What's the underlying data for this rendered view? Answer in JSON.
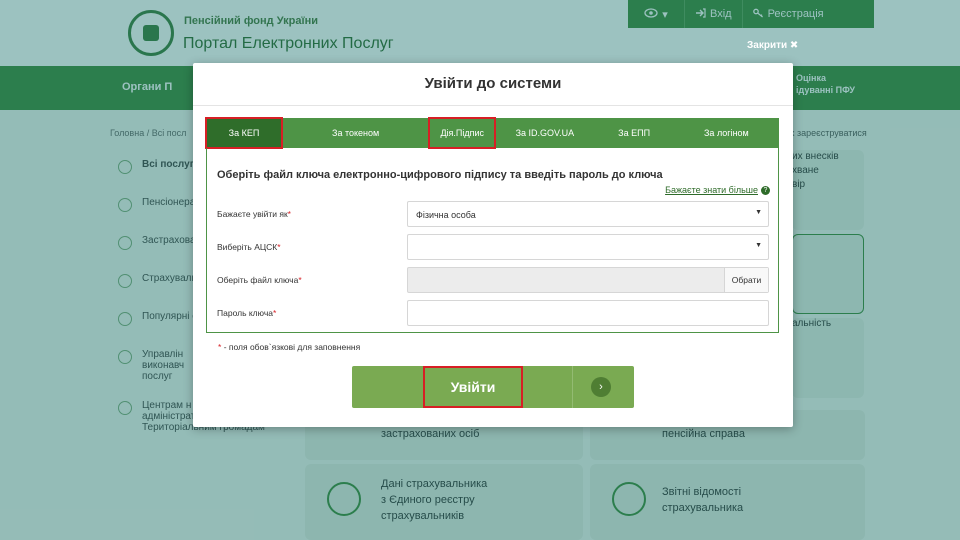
{
  "header": {
    "org_name": "Пенсійний фонд України",
    "portal_name": "Портал Електронних Послуг",
    "accessibility_caret": "▾",
    "login_label": "Вхід",
    "register_label": "Реєстрація",
    "close_label": "Закрити ✖"
  },
  "nav": {
    "left_label": "Органи П",
    "right_line1": "Оцінка",
    "right_line2": "ідуванні ПФУ"
  },
  "breadcrumb": "Головна / Всі посл",
  "register_hint": "х зареєструватися",
  "sidebar": {
    "items": [
      {
        "label": "Всі послуг"
      },
      {
        "label": "Пенсіонера"
      },
      {
        "label": "Застрахова"
      },
      {
        "label": "Страхуваль"
      },
      {
        "label": "Популярні с"
      },
      {
        "label": "Управлін\nвиконавч\nпослуг"
      },
      {
        "label": "Центрам н\nадміністративних послуг /\nТериторіальним громадам"
      }
    ]
  },
  "background_cards": {
    "card1": "застрахованих осіб",
    "card2": "пенсійна справа",
    "card3": "Дані страхувальника\nз Єдиного реєстру\nстрахувальників",
    "card4": "Звітні відомості\nстрахувальника",
    "right1": "их внесків\nхване\nвір",
    "right2": "альність"
  },
  "modal": {
    "title": "Увійти до системи",
    "tabs": [
      {
        "label": "За КЕП",
        "active": true
      },
      {
        "label": "За токеном",
        "active": false
      },
      {
        "label": "Дія.Підпис",
        "active": false
      },
      {
        "label": "За ID.GOV.UA",
        "active": false
      },
      {
        "label": "За ЕПП",
        "active": false
      },
      {
        "label": "За логіном",
        "active": false
      }
    ],
    "heading": "Оберіть файл ключа електронно-цифрового підпису та введіть пароль до ключа",
    "more_link": "Бажаєте знати більше",
    "fields": {
      "login_as": {
        "label": "Бажаєте увійти як",
        "value": "Фізична особа"
      },
      "acsk": {
        "label": "Виберіть АЦСК",
        "value": ""
      },
      "key_file": {
        "label": "Оберіть файл ключа",
        "value": "",
        "button": "Обрати"
      },
      "key_password": {
        "label": "Пароль ключа",
        "value": ""
      }
    },
    "required_note": "- поля обов`язкові для заповнення",
    "submit_label": "Увійти"
  },
  "colors": {
    "brand_green": "#3f8a3a",
    "tab_bar": "#4e9446",
    "active_tab": "#2f6d2a",
    "button_green": "#7aaa52",
    "highlight_red": "#d71f25"
  }
}
